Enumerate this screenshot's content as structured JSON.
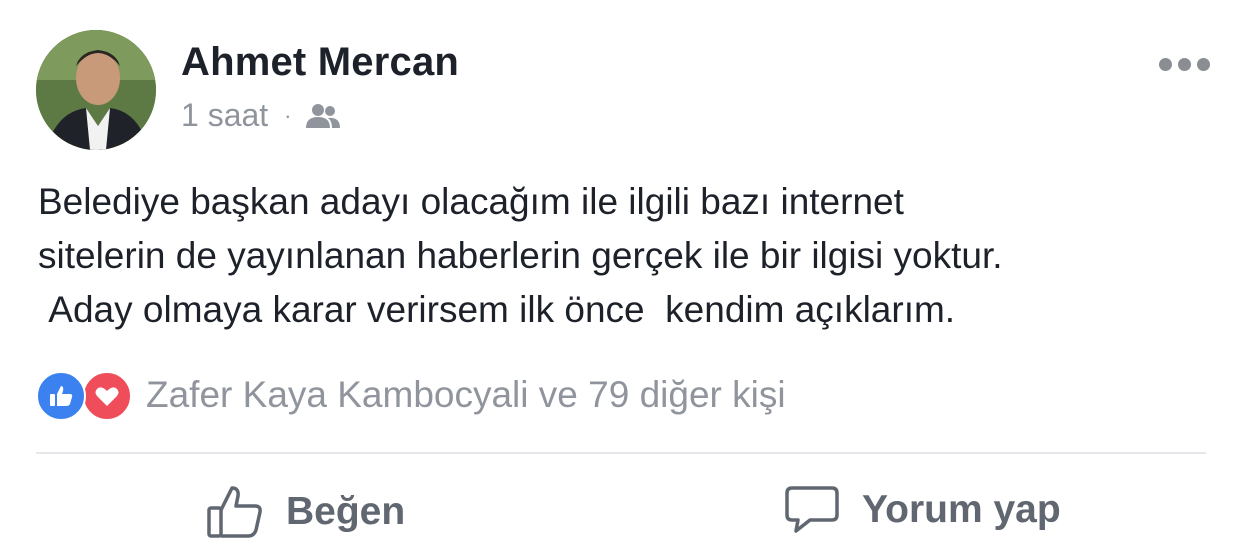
{
  "post": {
    "author": "Ahmet Mercan",
    "time": "1 saat",
    "separator": "·",
    "audience_icon": "friends-icon",
    "text": "Belediye başkan adayı olacağım ile ilgili bazı internet\nsitelerin de yayınlanan haberlerin gerçek ile bir ilgisi yoktur.\n Aday olmaya karar verirsem ilk önce  kendim açıklarım."
  },
  "reactions": {
    "icons": [
      "like-reaction-icon",
      "love-reaction-icon"
    ],
    "summary": "Zafer Kaya Kambocyali ve 79 diğer kişi"
  },
  "actions": {
    "like_label": "Beğen",
    "comment_label": "Yorum yap"
  },
  "colors": {
    "like_blue": "#3b82f0",
    "love_red": "#ef4d5a",
    "meta_gray": "#90949c",
    "action_gray": "#606770"
  }
}
